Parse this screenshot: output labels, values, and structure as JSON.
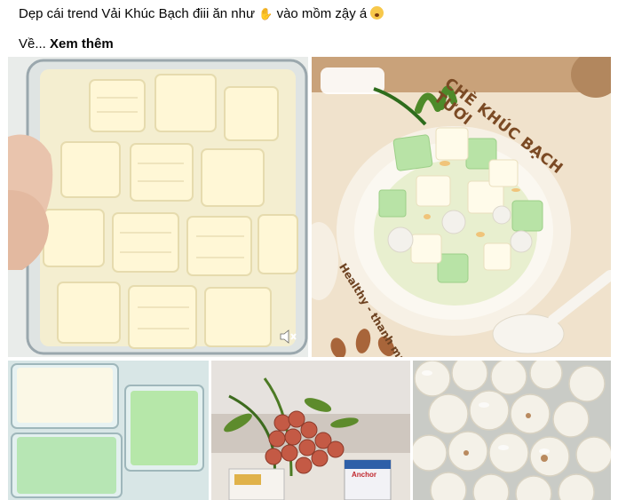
{
  "post": {
    "text_part1": "Dẹp cái trend Vải Khúc Bạch điii ăn như",
    "text_part2": "vào mồm zậy á",
    "text_prefix": "Về...",
    "see_more": "Xem thêm",
    "emoji1": "clapping-hands-icon",
    "emoji2": "flushed-face-icon"
  },
  "photo2": {
    "title": "CHÈ KHÚC BẠCH TƯƠI",
    "tagline": "Healthy - thanh mát"
  },
  "photo4": {
    "carton_brand": "Anchor"
  },
  "colors": {
    "jelly_white": "#fffbe6",
    "jelly_green": "#b5e3a3",
    "title_brown": "#7b4a24",
    "lychee_red": "#c45a45"
  }
}
